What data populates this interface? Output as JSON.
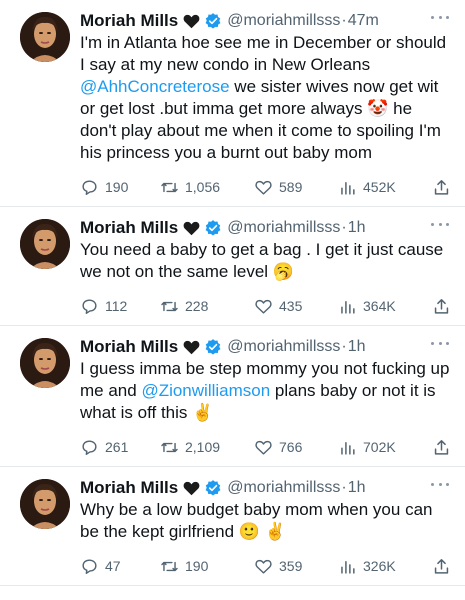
{
  "tweets": [
    {
      "name": "Moriah Mills",
      "handle": "@moriahmillsss",
      "sep": "·",
      "time": "47m",
      "text_parts": [
        {
          "t": "I'm in Atlanta hoe see me in December or should I say at my new condo in New Orleans "
        },
        {
          "t": "@AhhConcreterose",
          "mention": true
        },
        {
          "t": " we sister wives now get wit or get lost .but imma get more always 🤡 he don't play about me when it come to spoiling I'm his princess you a burnt out baby mom"
        }
      ],
      "replies": "190",
      "retweets": "1,056",
      "likes": "589",
      "views": "452K"
    },
    {
      "name": "Moriah Mills",
      "handle": "@moriahmillsss",
      "sep": "·",
      "time": "1h",
      "text_parts": [
        {
          "t": "You need a baby to get a bag . I get it just cause we not on the same level 🥱"
        }
      ],
      "replies": "112",
      "retweets": "228",
      "likes": "435",
      "views": "364K"
    },
    {
      "name": "Moriah Mills",
      "handle": "@moriahmillsss",
      "sep": "·",
      "time": "1h",
      "text_parts": [
        {
          "t": "I guess imma be step mommy you not fucking up me and "
        },
        {
          "t": "@Zionwilliamson",
          "mention": true
        },
        {
          "t": " plans baby or not it is what is off this ✌️"
        }
      ],
      "replies": "261",
      "retweets": "2,109",
      "likes": "766",
      "views": "702K"
    },
    {
      "name": "Moriah Mills",
      "handle": "@moriahmillsss",
      "sep": "·",
      "time": "1h",
      "text_parts": [
        {
          "t": "Why be a low budget baby mom when you can be the kept girlfriend 🙂 ✌️"
        }
      ],
      "replies": "47",
      "retweets": "190",
      "likes": "359",
      "views": "326K"
    }
  ],
  "icons": {
    "badge": "verified-badge-icon",
    "heart": "black-heart-icon",
    "more": "more-options-icon",
    "reply": "reply-icon",
    "retweet": "retweet-icon",
    "like": "like-icon",
    "views": "views-icon",
    "share": "share-icon"
  },
  "colors": {
    "accent": "#1d9bf0",
    "text": "#0f1419",
    "secondary": "#536471",
    "border": "#e6e9ec"
  }
}
